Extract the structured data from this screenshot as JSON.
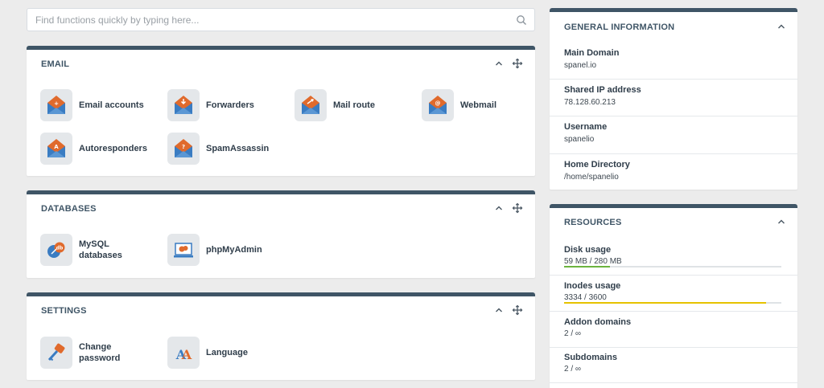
{
  "search": {
    "placeholder": "Find functions quickly by typing here..."
  },
  "email": {
    "title": "EMAIL",
    "items": [
      {
        "label": "Email accounts",
        "icon": "email-accounts-icon"
      },
      {
        "label": "Forwarders",
        "icon": "forwarders-icon"
      },
      {
        "label": "Mail route",
        "icon": "mail-route-icon"
      },
      {
        "label": "Webmail",
        "icon": "webmail-icon"
      },
      {
        "label": "Autoresponders",
        "icon": "autoresponders-icon"
      },
      {
        "label": "SpamAssassin",
        "icon": "spamassassin-icon"
      }
    ]
  },
  "databases": {
    "title": "DATABASES",
    "items": [
      {
        "label": "MySQL\ndatabases",
        "icon": "mysql-icon"
      },
      {
        "label": "phpMyAdmin",
        "icon": "phpmyadmin-icon"
      }
    ]
  },
  "settings": {
    "title": "SETTINGS",
    "items": [
      {
        "label": "Change\npassword",
        "icon": "key-icon"
      },
      {
        "label": "Language",
        "icon": "language-icon"
      }
    ]
  },
  "general": {
    "title": "GENERAL INFORMATION",
    "rows": [
      {
        "label": "Main Domain",
        "value": "spanel.io"
      },
      {
        "label": "Shared IP address",
        "value": "78.128.60.213"
      },
      {
        "label": "Username",
        "value": "spanelio"
      },
      {
        "label": "Home Directory",
        "value": "/home/spanelio"
      }
    ]
  },
  "resources": {
    "title": "RESOURCES",
    "rows": [
      {
        "label": "Disk usage",
        "value": "59 MB / 280 MB",
        "fraction": 0.21,
        "color": "#6cb33f"
      },
      {
        "label": "Inodes usage",
        "value": "3334 / 3600",
        "fraction": 0.93,
        "color": "#e6c200"
      },
      {
        "label": "Addon domains",
        "value": "2 / ∞"
      },
      {
        "label": "Subdomains",
        "value": "2 / ∞"
      }
    ]
  },
  "colors": {
    "panel_border": "#3f5566",
    "icon_orange": "#e06a2c",
    "icon_blue": "#3a7cc2",
    "background": "#ececec"
  }
}
